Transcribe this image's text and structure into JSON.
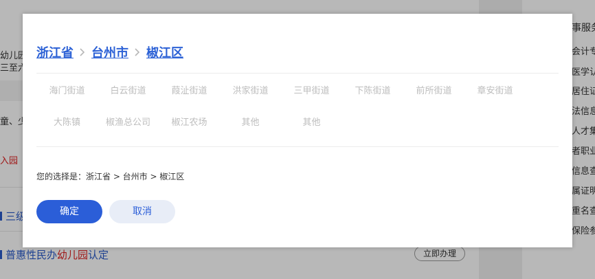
{
  "background": {
    "left_fragments": [
      "幼儿园",
      "三至六",
      "童、少"
    ],
    "red_link": "入园",
    "blue_item_1": "三级",
    "blue_item_2_parts": [
      "普惠性民办",
      "幼儿园",
      "认定"
    ],
    "action_button": "立即办理",
    "right_header": "事服务",
    "right_items": [
      "会计专",
      "医学认",
      "居住证",
      "法信息",
      "人才集",
      "者职业",
      "信息查",
      "属证明",
      "重名查",
      "保险参"
    ]
  },
  "modal": {
    "breadcrumb": [
      "浙江省",
      "台州市",
      "椒江区"
    ],
    "streets": [
      "海门街道",
      "白云街道",
      "葭沚街道",
      "洪家街道",
      "三甲街道",
      "下陈街道",
      "前所街道",
      "章安街道",
      "大陈镇",
      "椒渔总公司",
      "椒江农场",
      "其他",
      "其他"
    ],
    "selection_text": "您的选择是：浙江省 > 台州市 > 椒江区",
    "confirm_label": "确定",
    "cancel_label": "取消"
  },
  "colors": {
    "accent": "#2b5ed8",
    "cancel_bg": "#e8edf7",
    "street_text": "#bdbdbd"
  }
}
